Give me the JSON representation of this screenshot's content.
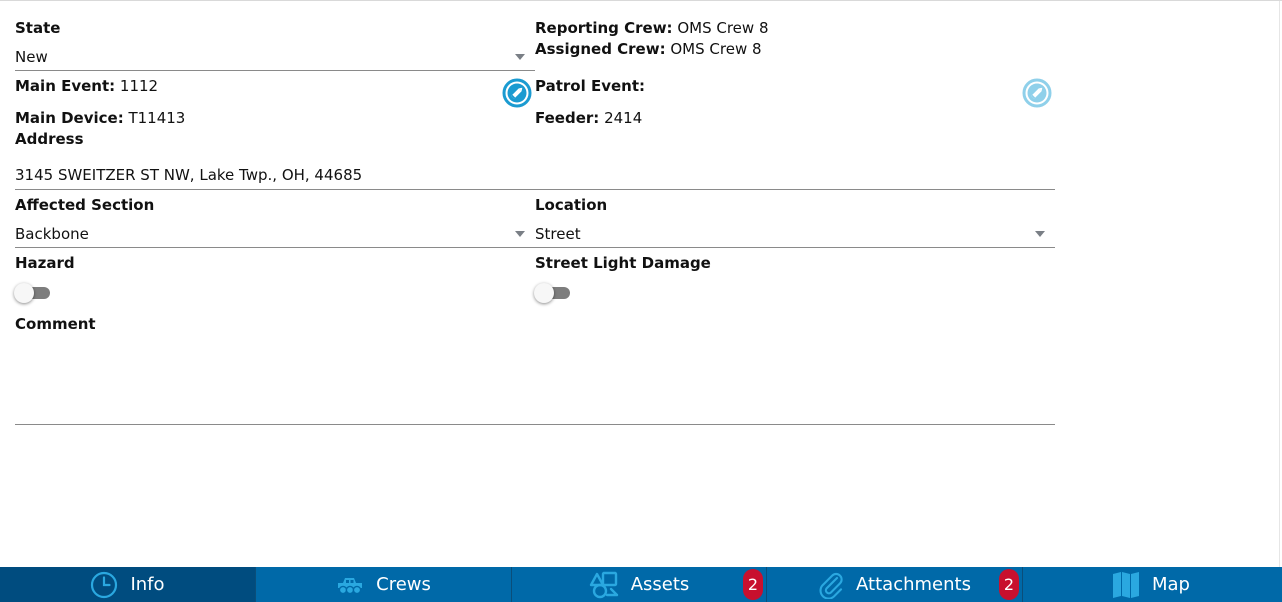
{
  "form": {
    "state": {
      "label": "State",
      "value": "New"
    },
    "reporting_crew": {
      "label": "Reporting Crew:",
      "value": " OMS Crew 8"
    },
    "assigned_crew": {
      "label": "Assigned Crew:",
      "value": " OMS Crew 8"
    },
    "main_event": {
      "label": "Main Event:",
      "value": " 1112"
    },
    "patrol_event": {
      "label": "Patrol Event:",
      "value": ""
    },
    "main_device": {
      "label": "Main Device:",
      "value": " T11413"
    },
    "feeder": {
      "label": "Feeder:",
      "value": " 2414"
    },
    "address": {
      "label": "Address",
      "value": "3145 SWEITZER ST NW, Lake Twp., OH, 44685"
    },
    "affected_section": {
      "label": "Affected Section",
      "value": "Backbone"
    },
    "location": {
      "label": "Location",
      "value": "Street"
    },
    "hazard": {
      "label": "Hazard",
      "on": false
    },
    "street_light_damage": {
      "label": "Street Light Damage",
      "on": false
    },
    "comment": {
      "label": "Comment",
      "value": ""
    }
  },
  "nav": {
    "tabs": [
      {
        "label": "Info",
        "icon": "clock-icon",
        "active": true
      },
      {
        "label": "Crews",
        "icon": "truck-icon"
      },
      {
        "label": "Assets",
        "icon": "assets-icon",
        "badge": "2"
      },
      {
        "label": "Attachments",
        "icon": "paperclip-icon",
        "badge": "2"
      },
      {
        "label": "Map",
        "icon": "map-icon"
      }
    ]
  },
  "colors": {
    "nav_bg": "#0069a8",
    "nav_active_bg": "#004c7f",
    "nav_icon": "#2aa8e0",
    "badge_bg": "#c8102e",
    "edit_icon": "#1b9bd1",
    "edit_icon_disabled": "#8fd0ea"
  }
}
